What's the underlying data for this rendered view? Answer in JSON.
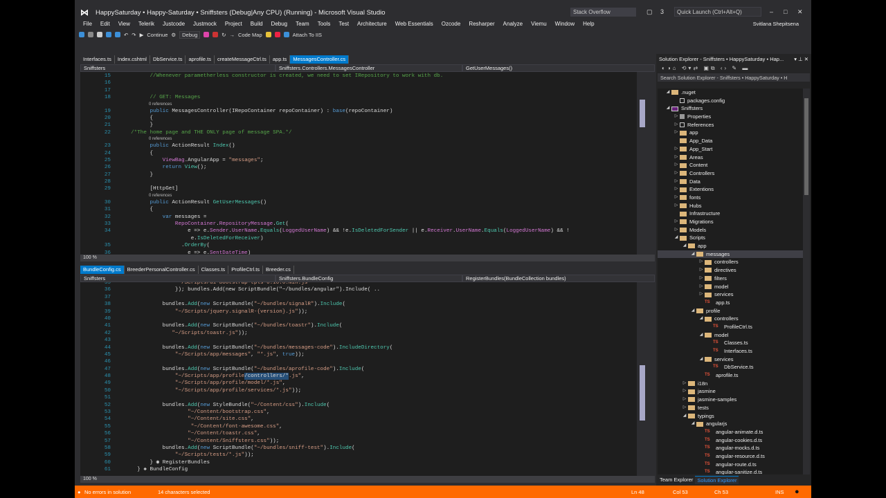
{
  "title": "HappySaturday • Happy-Saturday • Sniffsters (Debug|Any CPU) (Running) - Microsoft Visual Studio",
  "search_box": "Stack Overflow",
  "notifications": "3",
  "quick_launch": "Quick Launch (Ctrl+Alt+Q)",
  "user": "Svitlana Shepitsena",
  "menu": [
    "File",
    "Edit",
    "View",
    "Telerik",
    "Justcode",
    "Justmock",
    "Project",
    "Build",
    "Debug",
    "Team",
    "Tools",
    "Test",
    "Architecture",
    "Web Essentials",
    "Ozcode",
    "Resharper",
    "Analyze",
    "Viemu",
    "Window",
    "Help"
  ],
  "toolbar": {
    "continue": "Continue",
    "config": "Debug",
    "code_map": "Code Map",
    "attach": "Attach To IIS"
  },
  "top_tabs": [
    "Interfaces.ts",
    "Index.cshtml",
    "DbService.ts",
    "aprofile.ts",
    "createMessageCtrl.ts",
    "app.ts",
    "MessagesController.cs"
  ],
  "top_nav": [
    "Sniffsters",
    "Sniffsters.Controllers.MessagesController",
    "GetUserMessages()"
  ],
  "lens": "0 references",
  "top_code": [
    {
      "n": "15",
      "seg": [
        [
          "        //Whenever parametherless constructor is created, we need to set IRepository to work with db.",
          "c"
        ]
      ]
    },
    {
      "n": "16",
      "seg": []
    },
    {
      "n": "17",
      "seg": []
    },
    {
      "n": "18",
      "seg": [
        [
          "        // GET: Messages",
          "c"
        ]
      ],
      "lens": true
    },
    {
      "n": "19",
      "seg": [
        [
          "        public ",
          "k"
        ],
        [
          "MessagesController(IRepoContainer repoContainer) : ",
          "t"
        ],
        [
          "base",
          "k"
        ],
        [
          "(repoContainer)",
          "t"
        ]
      ]
    },
    {
      "n": "20",
      "seg": [
        [
          "        {",
          "t"
        ]
      ]
    },
    {
      "n": "21",
      "seg": [
        [
          "        }",
          "t"
        ]
      ]
    },
    {
      "n": "22",
      "seg": [
        [
          "  /*The home page and THE ONLY page of message SPA.*/",
          "c"
        ]
      ],
      "lens": true
    },
    {
      "n": "23",
      "seg": [
        [
          "        public ",
          "k"
        ],
        [
          "ActionResult ",
          "t"
        ],
        [
          "Index",
          "m"
        ],
        [
          "()",
          "t"
        ]
      ]
    },
    {
      "n": "24",
      "seg": [
        [
          "        {",
          "t"
        ]
      ]
    },
    {
      "n": "25",
      "seg": [
        [
          "            ViewBag",
          "p"
        ],
        [
          ".AngularApp = ",
          "t"
        ],
        [
          "\"messages\"",
          "s"
        ],
        [
          ";",
          "t"
        ]
      ]
    },
    {
      "n": "26",
      "seg": [
        [
          "            return ",
          "k"
        ],
        [
          "View",
          "m"
        ],
        [
          "();",
          "t"
        ]
      ]
    },
    {
      "n": "27",
      "seg": [
        [
          "        }",
          "t"
        ]
      ]
    },
    {
      "n": "28",
      "seg": []
    },
    {
      "n": "29",
      "seg": [
        [
          "        [HttpGet]",
          "t"
        ]
      ],
      "lens": true
    },
    {
      "n": "30",
      "seg": [
        [
          "        public ",
          "k"
        ],
        [
          "ActionResult ",
          "t"
        ],
        [
          "GetUserMessages",
          "m"
        ],
        [
          "()",
          "t"
        ]
      ]
    },
    {
      "n": "31",
      "seg": [
        [
          "        {",
          "t"
        ]
      ]
    },
    {
      "n": "32",
      "seg": [
        [
          "            var ",
          "k"
        ],
        [
          "messages =",
          "t"
        ]
      ]
    },
    {
      "n": "33",
      "seg": [
        [
          "                RepoContainer",
          "p"
        ],
        [
          ".",
          "t"
        ],
        [
          "RepositoryMessage",
          "p"
        ],
        [
          ".",
          "t"
        ],
        [
          "Get",
          "m"
        ],
        [
          "(",
          "t"
        ]
      ]
    },
    {
      "n": "34",
      "seg": [
        [
          "                    e => e.",
          "t"
        ],
        [
          "Sender",
          "p"
        ],
        [
          ".",
          "t"
        ],
        [
          "UserName",
          "p"
        ],
        [
          ".",
          "t"
        ],
        [
          "Equals",
          "m"
        ],
        [
          "(",
          "t"
        ],
        [
          "LoggedUserName",
          "p"
        ],
        [
          ") && !e.",
          "t"
        ],
        [
          "IsDeletedForSender",
          "m"
        ],
        [
          " || e.",
          "t"
        ],
        [
          "Receiver",
          "p"
        ],
        [
          ".",
          "t"
        ],
        [
          "UserName",
          "p"
        ],
        [
          ".",
          "t"
        ],
        [
          "Equals",
          "m"
        ],
        [
          "(",
          "t"
        ],
        [
          "LoggedUserName",
          "p"
        ],
        [
          ") && !",
          "t"
        ]
      ]
    },
    {
      "n": "",
      "seg": [
        [
          "                     e.",
          "t"
        ],
        [
          "IsDeletedForReceiver",
          "m"
        ],
        [
          ")",
          "t"
        ]
      ]
    },
    {
      "n": "35",
      "seg": [
        [
          "                  .",
          "t"
        ],
        [
          "OrderBy",
          "m"
        ],
        [
          "(",
          "t"
        ]
      ]
    },
    {
      "n": "36",
      "seg": [
        [
          "                    e => e.",
          "t"
        ],
        [
          "SentDateTime",
          "p"
        ],
        [
          ")",
          "t"
        ]
      ]
    }
  ],
  "bottom_tabs": [
    "BundleConfig.cs",
    "BreederPersonalController.cs",
    "Classes.ts",
    "ProfileCtrl.ts",
    "Breeder.cs"
  ],
  "bottom_nav": [
    "Sniffsters",
    "Sniffsters.BundleConfig",
    "RegisterBundles(BundleCollection bundles)"
  ],
  "bottom_code": [
    {
      "n": "35",
      "seg": [
        [
          "                \"~/Scripts/ui-bootstrap-tpls-0.10.0.min.js",
          "s"
        ]
      ]
    },
    {
      "n": "36",
      "seg": [
        [
          "                }); bundles.Add(new ScriptBundle(\"~/bundles/angular\").Include( ..",
          "t"
        ]
      ]
    },
    {
      "n": "37",
      "seg": []
    },
    {
      "n": "38",
      "seg": [
        [
          "            bundles.",
          "t"
        ],
        [
          "Add",
          "m"
        ],
        [
          "(",
          "t"
        ],
        [
          "new ",
          "k"
        ],
        [
          "ScriptBundle(",
          "t"
        ],
        [
          "\"~/bundles/signalR\"",
          "s"
        ],
        [
          ").",
          "t"
        ],
        [
          "Include",
          "m"
        ],
        [
          "(",
          "t"
        ]
      ]
    },
    {
      "n": "39",
      "seg": [
        [
          "                ",
          "t"
        ],
        [
          "\"~/Scripts/jquery.signalR-{version}.js\"",
          "s"
        ],
        [
          "));",
          "t"
        ]
      ]
    },
    {
      "n": "40",
      "seg": []
    },
    {
      "n": "41",
      "seg": [
        [
          "            bundles.",
          "t"
        ],
        [
          "Add",
          "m"
        ],
        [
          "(",
          "t"
        ],
        [
          "new ",
          "k"
        ],
        [
          "ScriptBundle(",
          "t"
        ],
        [
          "\"~/bundles/toastr\"",
          "s"
        ],
        [
          ").",
          "t"
        ],
        [
          "Include",
          "m"
        ],
        [
          "(",
          "t"
        ]
      ]
    },
    {
      "n": "42",
      "seg": [
        [
          "               ",
          "t"
        ],
        [
          "\"~/Scripts/toastr.js\"",
          "s"
        ],
        [
          "));",
          "t"
        ]
      ]
    },
    {
      "n": "43",
      "seg": []
    },
    {
      "n": "44",
      "seg": [
        [
          "            bundles.",
          "t"
        ],
        [
          "Add",
          "m"
        ],
        [
          "(",
          "t"
        ],
        [
          "new ",
          "k"
        ],
        [
          "ScriptBundle(",
          "t"
        ],
        [
          "\"~/bundles/messages-code\"",
          "s"
        ],
        [
          ").",
          "t"
        ],
        [
          "IncludeDirectory",
          "m"
        ],
        [
          "(",
          "t"
        ]
      ]
    },
    {
      "n": "45",
      "seg": [
        [
          "                ",
          "t"
        ],
        [
          "\"~/Scripts/app/messages\"",
          "s"
        ],
        [
          ", ",
          "t"
        ],
        [
          "\"*.js\"",
          "s"
        ],
        [
          ", ",
          "t"
        ],
        [
          "true",
          "k"
        ],
        [
          "));",
          "t"
        ]
      ]
    },
    {
      "n": "46",
      "seg": []
    },
    {
      "n": "47",
      "seg": [
        [
          "            bundles.",
          "t"
        ],
        [
          "Add",
          "m"
        ],
        [
          "(",
          "t"
        ],
        [
          "new ",
          "k"
        ],
        [
          "ScriptBundle(",
          "t"
        ],
        [
          "\"~/bundles/aprofile-code\"",
          "s"
        ],
        [
          ").",
          "t"
        ],
        [
          "Include",
          "m"
        ],
        [
          "(",
          "t"
        ]
      ]
    },
    {
      "n": "48",
      "seg": [
        [
          "                \"~/Scripts/app/profile",
          "s"
        ],
        [
          "/controllers/*",
          "sel"
        ],
        [
          ".js\"",
          "s"
        ],
        [
          ",",
          "t"
        ]
      ]
    },
    {
      "n": "49",
      "seg": [
        [
          "                \"~/Scripts/app/profile/model/*.js\"",
          "s"
        ],
        [
          ",",
          "t"
        ]
      ]
    },
    {
      "n": "50",
      "seg": [
        [
          "                \"~/Scripts/app/profile/services/*.js\"",
          "s"
        ],
        [
          "));",
          "t"
        ]
      ]
    },
    {
      "n": "51",
      "seg": []
    },
    {
      "n": "52",
      "seg": [
        [
          "            bundles.",
          "t"
        ],
        [
          "Add",
          "m"
        ],
        [
          "(",
          "t"
        ],
        [
          "new ",
          "k"
        ],
        [
          "StyleBundle(",
          "t"
        ],
        [
          "\"~/Content/css\"",
          "s"
        ],
        [
          ").",
          "t"
        ],
        [
          "Include",
          "m"
        ],
        [
          "(",
          "t"
        ]
      ]
    },
    {
      "n": "53",
      "seg": [
        [
          "                    \"~/Content/bootstrap.css\"",
          "s"
        ],
        [
          ",",
          "t"
        ]
      ]
    },
    {
      "n": "54",
      "seg": [
        [
          "                    \"~/Content/site.css\"",
          "s"
        ],
        [
          ",",
          "t"
        ]
      ]
    },
    {
      "n": "55",
      "seg": [
        [
          "                     \"~/Content/font-awesome.css\"",
          "s"
        ],
        [
          ",",
          "t"
        ]
      ]
    },
    {
      "n": "56",
      "seg": [
        [
          "                    \"~/Content/toastr.css\"",
          "s"
        ],
        [
          ",",
          "t"
        ]
      ]
    },
    {
      "n": "57",
      "seg": [
        [
          "                    \"~/Content/Sniffsters.css\"",
          "s"
        ],
        [
          "));",
          "t"
        ]
      ]
    },
    {
      "n": "58",
      "seg": [
        [
          "            bundles.",
          "t"
        ],
        [
          "Add",
          "m"
        ],
        [
          "(",
          "t"
        ],
        [
          "new ",
          "k"
        ],
        [
          "ScriptBundle(",
          "t"
        ],
        [
          "\"~/bundles/sniff-test\"",
          "s"
        ],
        [
          ").",
          "t"
        ],
        [
          "Include",
          "m"
        ],
        [
          "(",
          "t"
        ]
      ]
    },
    {
      "n": "59",
      "seg": [
        [
          "                \"~/Scripts/tests/*.js\"",
          "s"
        ],
        [
          "));",
          "t"
        ]
      ]
    },
    {
      "n": "60",
      "seg": [
        [
          "        } ◉ RegisterBundles",
          "t"
        ]
      ]
    },
    {
      "n": "61",
      "seg": [
        [
          "    } ◈ BundleConfig",
          "t"
        ]
      ]
    }
  ],
  "zoom": "100 %",
  "solution_explorer": {
    "title": "Solution Explorer - Sniffsters • HappySaturday • Hap...",
    "search": "Search Solution Explorer - Sniffsters • HappySaturday • H",
    "tabs": [
      "Team Explorer",
      "Solution Explorer"
    ],
    "items": [
      {
        "l": ".nuget",
        "d": 0,
        "e": "open",
        "i": "folder"
      },
      {
        "l": "packages.config",
        "d": 1,
        "e": "",
        "i": "file"
      },
      {
        "l": "Sniffsters",
        "d": 0,
        "e": "open",
        "i": "proj"
      },
      {
        "l": "Properties",
        "d": 1,
        "e": "closed",
        "i": "wrench"
      },
      {
        "l": "References",
        "d": 1,
        "e": "closed",
        "i": "file"
      },
      {
        "l": "app",
        "d": 1,
        "e": "closed",
        "i": "folder"
      },
      {
        "l": "App_Data",
        "d": 1,
        "e": "",
        "i": "folder"
      },
      {
        "l": "App_Start",
        "d": 1,
        "e": "closed",
        "i": "folder"
      },
      {
        "l": "Areas",
        "d": 1,
        "e": "closed",
        "i": "folder"
      },
      {
        "l": "Content",
        "d": 1,
        "e": "closed",
        "i": "folder"
      },
      {
        "l": "Controllers",
        "d": 1,
        "e": "closed",
        "i": "folder"
      },
      {
        "l": "Data",
        "d": 1,
        "e": "closed",
        "i": "folder"
      },
      {
        "l": "Extentions",
        "d": 1,
        "e": "closed",
        "i": "folder"
      },
      {
        "l": "fonts",
        "d": 1,
        "e": "closed",
        "i": "folder"
      },
      {
        "l": "Hubs",
        "d": 1,
        "e": "closed",
        "i": "folder"
      },
      {
        "l": "Infrastructure",
        "d": 1,
        "e": "",
        "i": "folder"
      },
      {
        "l": "Migrations",
        "d": 1,
        "e": "closed",
        "i": "folder"
      },
      {
        "l": "Models",
        "d": 1,
        "e": "closed",
        "i": "folder"
      },
      {
        "l": "Scripts",
        "d": 1,
        "e": "open",
        "i": "folder"
      },
      {
        "l": "app",
        "d": 2,
        "e": "open",
        "i": "folder"
      },
      {
        "l": "messages",
        "d": 3,
        "e": "open",
        "i": "folder",
        "hl": true
      },
      {
        "l": "controllers",
        "d": 4,
        "e": "closed",
        "i": "folder"
      },
      {
        "l": "directives",
        "d": 4,
        "e": "closed",
        "i": "folder"
      },
      {
        "l": "filters",
        "d": 4,
        "e": "closed",
        "i": "folder"
      },
      {
        "l": "model",
        "d": 4,
        "e": "closed",
        "i": "folder"
      },
      {
        "l": "services",
        "d": 4,
        "e": "closed",
        "i": "folder"
      },
      {
        "l": "app.ts",
        "d": 4,
        "e": "",
        "i": "ts"
      },
      {
        "l": "profile",
        "d": 3,
        "e": "open",
        "i": "folder"
      },
      {
        "l": "controllers",
        "d": 4,
        "e": "open",
        "i": "folder"
      },
      {
        "l": "ProfileCtrl.ts",
        "d": 5,
        "e": "",
        "i": "ts"
      },
      {
        "l": "model",
        "d": 4,
        "e": "open",
        "i": "folder"
      },
      {
        "l": "Classes.ts",
        "d": 5,
        "e": "",
        "i": "ts"
      },
      {
        "l": "Interfaces.ts",
        "d": 5,
        "e": "",
        "i": "ts"
      },
      {
        "l": "services",
        "d": 4,
        "e": "open",
        "i": "folder"
      },
      {
        "l": "DbService.ts",
        "d": 5,
        "e": "",
        "i": "ts"
      },
      {
        "l": "aprofile.ts",
        "d": 4,
        "e": "",
        "i": "ts"
      },
      {
        "l": "i18n",
        "d": 2,
        "e": "closed",
        "i": "folder"
      },
      {
        "l": "jasmine",
        "d": 2,
        "e": "closed",
        "i": "folder"
      },
      {
        "l": "jasmine-samples",
        "d": 2,
        "e": "closed",
        "i": "folder"
      },
      {
        "l": "tests",
        "d": 2,
        "e": "closed",
        "i": "folder"
      },
      {
        "l": "typings",
        "d": 2,
        "e": "open",
        "i": "folder"
      },
      {
        "l": "angularjs",
        "d": 3,
        "e": "open",
        "i": "folder"
      },
      {
        "l": "angular-animate.d.ts",
        "d": 4,
        "e": "",
        "i": "ts"
      },
      {
        "l": "angular-cookies.d.ts",
        "d": 4,
        "e": "",
        "i": "ts"
      },
      {
        "l": "angular-mocks.d.ts",
        "d": 4,
        "e": "",
        "i": "ts"
      },
      {
        "l": "angular-resource.d.ts",
        "d": 4,
        "e": "",
        "i": "ts"
      },
      {
        "l": "angular-route.d.ts",
        "d": 4,
        "e": "",
        "i": "ts"
      },
      {
        "l": "angular-sanitize.d.ts",
        "d": 4,
        "e": "",
        "i": "ts"
      }
    ]
  },
  "status": {
    "errors": "No errors in solution",
    "selection": "14 characters selected",
    "ln": "Ln 48",
    "col": "Col 53",
    "ch": "Ch 53",
    "mode": "INS"
  }
}
